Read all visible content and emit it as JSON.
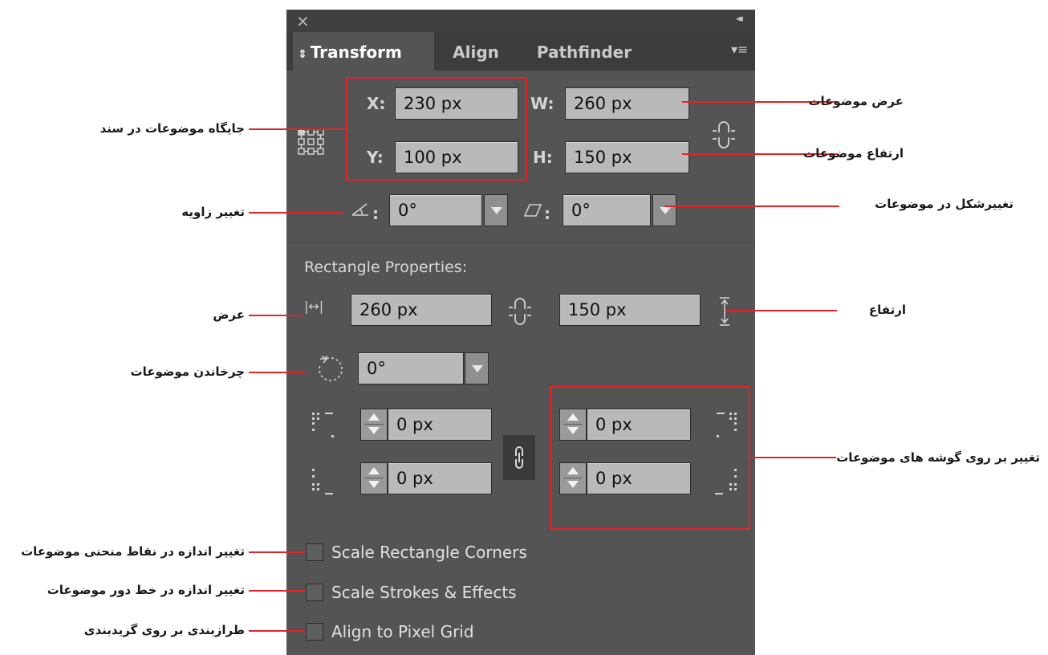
{
  "panel": {
    "close_glyph": "×",
    "collapse_glyph": "◂◂",
    "menu_glyph": "▾≡",
    "tabs": [
      {
        "label": "Transform",
        "active": true,
        "prefix": "⇕"
      },
      {
        "label": "Align",
        "active": false
      },
      {
        "label": "Pathfinder",
        "active": false
      }
    ],
    "transform": {
      "x_label": "X:",
      "x_value": "230 px",
      "y_label": "Y:",
      "y_value": "100 px",
      "w_label": "W:",
      "w_value": "260 px",
      "h_label": "H:",
      "h_value": "150 px",
      "rotate_value": "0°",
      "shear_value": "0°"
    },
    "rectangle_properties": {
      "heading": "Rectangle Properties:",
      "width_value": "260 px",
      "height_value": "150 px",
      "rotate_value": "0°",
      "corner_tl": "0 px",
      "corner_tr": "0 px",
      "corner_bl": "0 px",
      "corner_br": "0 px"
    },
    "checkboxes": [
      {
        "label": "Scale Rectangle Corners",
        "checked": false
      },
      {
        "label": "Scale Strokes & Effects",
        "checked": false
      },
      {
        "label": "Align to Pixel Grid",
        "checked": false
      }
    ]
  },
  "annotations": {
    "position": "جایگاه موضوعات در سند",
    "rotate": "تغییر زاویه",
    "width": "عرض",
    "rotate_objects": "چرخاندن موضوعات",
    "scale_corners": "تغییر اندازه در نقاط منحنی موضوعات",
    "scale_strokes": "تغییر اندازه در خط دور موضوعات",
    "align_grid": "طرازبندی بر روی گریدبندی",
    "object_width": "عرض موضوعات",
    "object_height": "ارتفاع موضوعات",
    "shear": "تغییرشکل در موضوعات",
    "height": "ارتفاع",
    "corners": "تغییر بر روی گوشه های موضوعات"
  },
  "colors": {
    "panel_bg": "#545454",
    "field_bg": "#b9b9b9",
    "callout_red": "#e2232a"
  }
}
